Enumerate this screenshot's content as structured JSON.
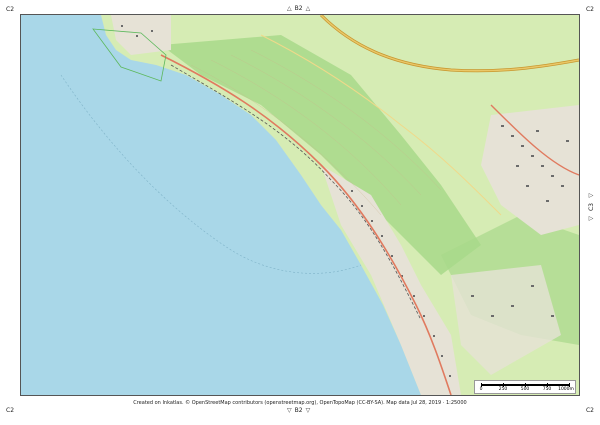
{
  "grid": {
    "top_label": "B2",
    "bottom_label": "B2",
    "right_label": "C3",
    "corner_top_left": "C2",
    "corner_top_right": "C2",
    "corner_bottom_left": "C2",
    "corner_bottom_right": "C2"
  },
  "attribution": "Created on Inkatlas. © OpenStreetMap contributors (openstreetmap.org), OpenTopoMap (CC-BY-SA). Map data Jul 28, 2019 · 1:25000",
  "scale": {
    "ticks": [
      "0",
      "250",
      "500",
      "750",
      "1000m"
    ]
  },
  "colors": {
    "water": "#a9d7e8",
    "land_green": "#cfe9a8",
    "forest": "#9fd27a",
    "urban": "#e8e4d8",
    "road_major": "#e07a5f",
    "road_yellow": "#e8c35a",
    "highway": "#b5651d"
  }
}
